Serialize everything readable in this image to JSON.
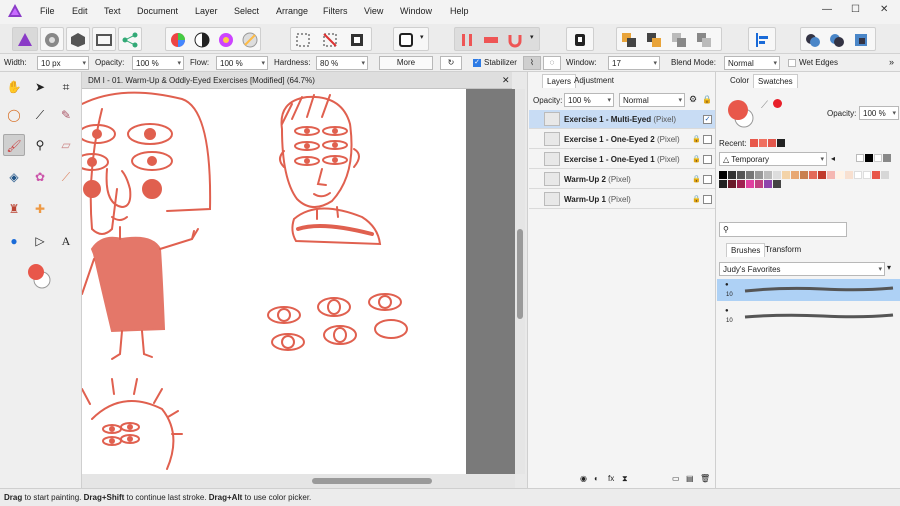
{
  "menu": [
    "File",
    "Edit",
    "Text",
    "Document",
    "Layer",
    "Select",
    "Arrange",
    "Filters",
    "View",
    "Window",
    "Help"
  ],
  "window_controls": {
    "minimize": "—",
    "maximize": "☐",
    "close": "✕"
  },
  "context": {
    "width_label": "Width:",
    "width_value": "10 px",
    "opacity_label": "Opacity:",
    "opacity_value": "100 %",
    "flow_label": "Flow:",
    "flow_value": "100 %",
    "hardness_label": "Hardness:",
    "hardness_value": "80 %",
    "more_label": "More",
    "stabilizer_label": "Stabilizer",
    "window_label": "Window:",
    "window_value": "17",
    "blend_label": "Blend Mode:",
    "blend_value": "Normal",
    "wet_label": "Wet Edges"
  },
  "document_tab": "DM I - 01. Warm-Up & Oddly-Eyed Exercises [Modified] (64.7%)",
  "status": {
    "t1": "Drag",
    "t2": " to start painting. ",
    "t3": "Drag+Shift",
    "t4": " to continue last stroke. ",
    "t5": "Drag+Alt",
    "t6": " to use color picker."
  },
  "layers": {
    "tabs": [
      "Layers",
      "Adjustment"
    ],
    "opacity_label": "Opacity:",
    "opacity_value": "100 %",
    "blend_value": "Normal",
    "rows": [
      {
        "name": "Exercise 1 - Multi-Eyed",
        "type": "(Pixel)",
        "selected": true
      },
      {
        "name": "Exercise 1 - One-Eyed 2",
        "type": "(Pixel)",
        "selected": false
      },
      {
        "name": "Exercise 1 - One-Eyed 1",
        "type": "(Pixel)",
        "selected": false
      },
      {
        "name": "Warm-Up 2",
        "type": "(Pixel)",
        "selected": false
      },
      {
        "name": "Warm-Up 1",
        "type": "(Pixel)",
        "selected": false
      }
    ]
  },
  "color": {
    "tabs": [
      "Color",
      "Swatches"
    ],
    "opacity_label": "Opacity:",
    "opacity_value": "100 %",
    "recent_label": "Recent:",
    "palette_value": "Temporary",
    "accent": "#e8574a",
    "recent_colors": [
      "#e8574a",
      "#f07060",
      "#e2574c",
      "#222222"
    ]
  },
  "brushes": {
    "tabs": [
      "Brushes",
      "Transform"
    ],
    "category": "Judy's Favorites",
    "items": [
      {
        "size": "10"
      },
      {
        "size": "10"
      }
    ]
  }
}
